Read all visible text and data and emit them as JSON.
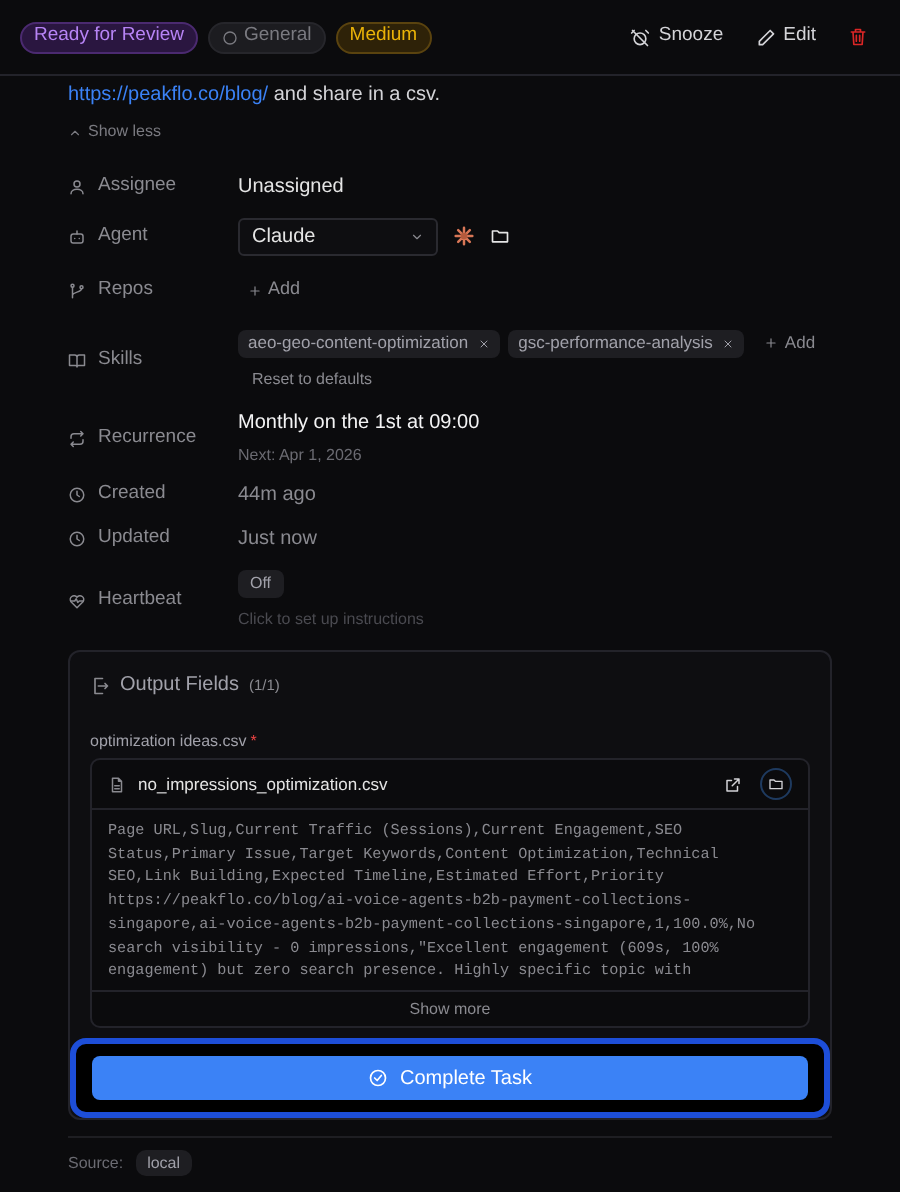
{
  "header": {
    "badges": [
      {
        "label": "Ready for Review",
        "kind": "status"
      },
      {
        "label": "General",
        "kind": "category"
      },
      {
        "label": "Medium",
        "kind": "priority"
      }
    ],
    "actions": [
      {
        "label": "Snooze",
        "kind": "snooze"
      },
      {
        "label": "Edit",
        "kind": "edit"
      },
      {
        "kind": "delete"
      }
    ]
  },
  "description": {
    "link": "https://peakflo.co/blog/",
    "text": " and share in a csv.",
    "toggle": "Show less"
  },
  "properties": [
    {
      "kind": "text",
      "label": "Assignee",
      "value": "Unassigned"
    },
    {
      "kind": "select",
      "label": "Agent",
      "value": "Claude"
    },
    {
      "kind": "add",
      "label": "Repos",
      "add": "Add"
    },
    {
      "kind": "chips",
      "label": "Skills",
      "chips": [
        "aeo-geo-content-optimization",
        "gsc-performance-analysis"
      ],
      "add": "Add",
      "reset": "Reset to defaults"
    },
    {
      "kind": "recurrence",
      "label": "Recurrence",
      "value": "Monthly on the 1st at 09:00",
      "sub": "Next: Apr 1, 2026"
    },
    {
      "kind": "muted",
      "label": "Created",
      "value": "44m ago"
    },
    {
      "kind": "muted",
      "label": "Updated",
      "value": "Just now"
    },
    {
      "kind": "heartbeat",
      "label": "Heartbeat",
      "value": "Off",
      "hint": "Click to set up instructions"
    }
  ],
  "output": {
    "title": "Output Fields",
    "count": "(1/1)",
    "field_label": "optimization ideas.csv",
    "required_mark": "*",
    "file_name": "no_impressions_optimization.csv",
    "preview": [
      "Page URL,Slug,Current Traffic (Sessions),Current Engagement,SEO",
      "Status,Primary Issue,Target Keywords,Content Optimization,Technical",
      "SEO,Link Building,Expected Timeline,Estimated Effort,Priority",
      "https://peakflo.co/blog/ai-voice-agents-b2b-payment-collections-",
      "singapore,ai-voice-agents-b2b-payment-collections-singapore,1,100.0%,No",
      "search visibility - 0 impressions,\"Excellent engagement (609s, 100%",
      "engagement) but zero search presence. Highly specific topic with"
    ],
    "show_more": "Show more",
    "complete": "Complete Task"
  },
  "source": {
    "label": "Source:",
    "value": "local"
  }
}
